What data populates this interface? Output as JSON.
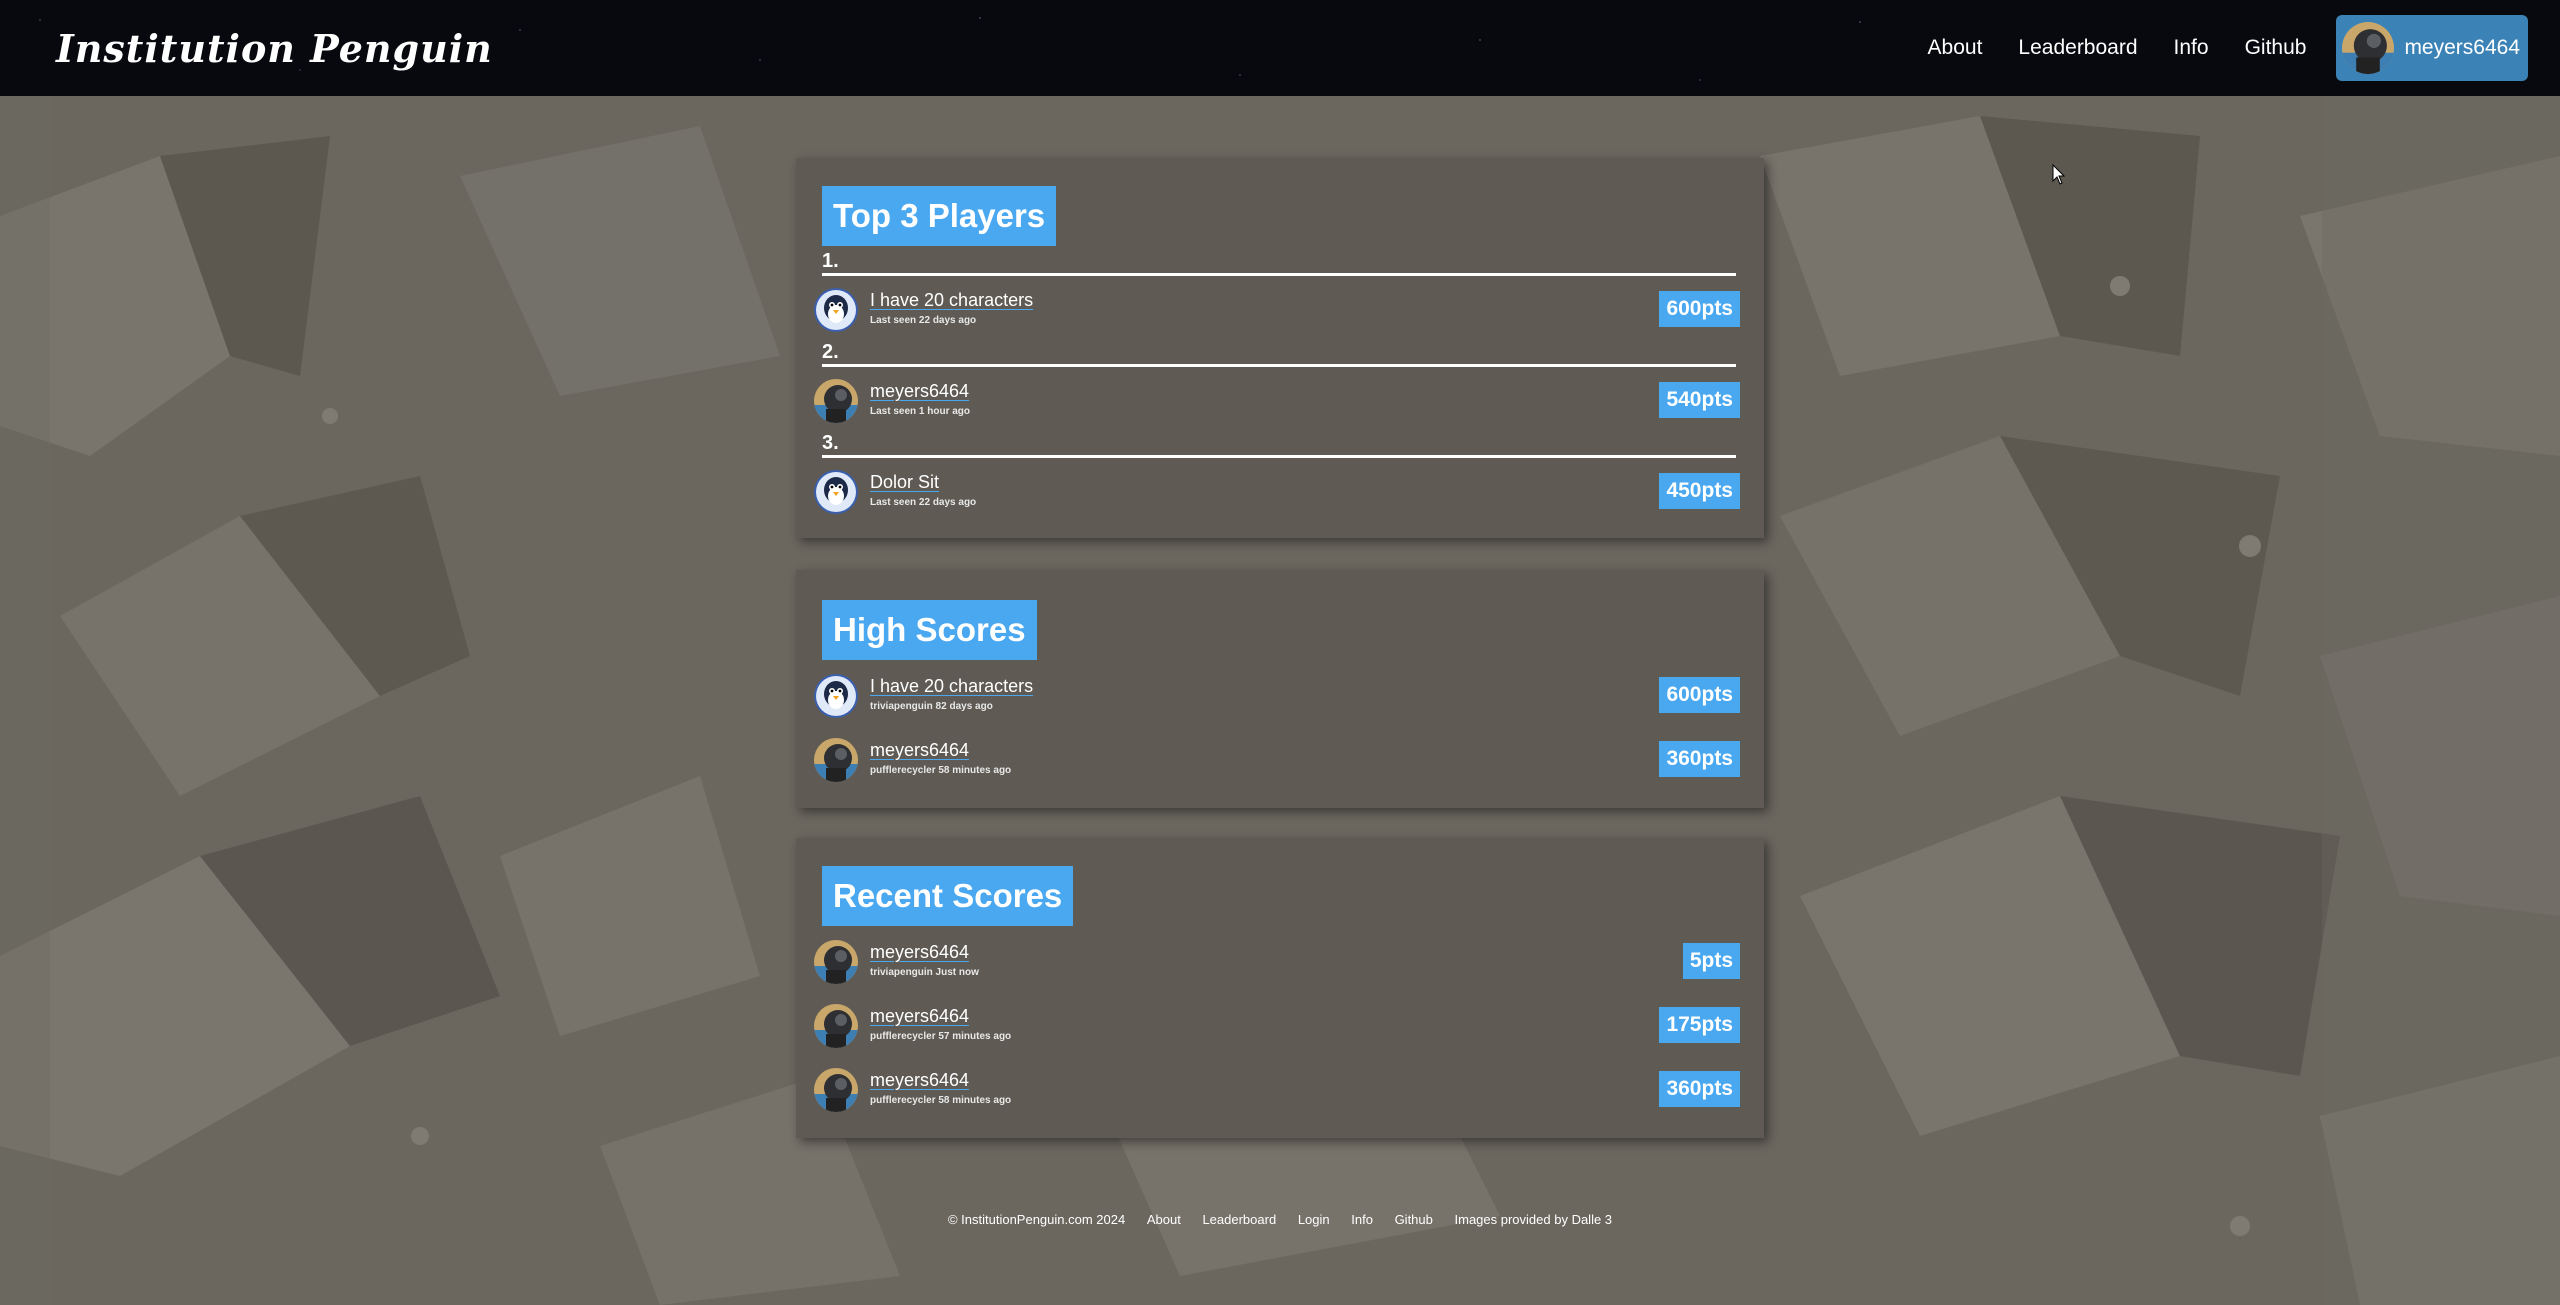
{
  "header": {
    "brand": "Institution Penguin",
    "nav": [
      "About",
      "Leaderboard",
      "Info",
      "Github"
    ],
    "user": "meyers6464"
  },
  "top3": {
    "title": "Top 3 Players",
    "ranks": [
      "1.",
      "2.",
      "3."
    ],
    "players": [
      {
        "name": "I have 20 characters",
        "sub": "Last seen 22 days ago",
        "pts": "600pts",
        "avatar": "penguin-avatar"
      },
      {
        "name": "meyers6464",
        "sub": "Last seen 1 hour ago",
        "pts": "540pts",
        "avatar": "user-photo-avatar"
      },
      {
        "name": "Dolor Sit",
        "sub": "Last seen 22 days ago",
        "pts": "450pts",
        "avatar": "penguin-avatar"
      }
    ]
  },
  "high_scores": {
    "title": "High Scores",
    "rows": [
      {
        "name": "I have 20 characters",
        "sub": "triviapenguin 82 days ago",
        "pts": "600pts",
        "avatar": "penguin-avatar"
      },
      {
        "name": "meyers6464",
        "sub": "pufflerecycler 58 minutes ago",
        "pts": "360pts",
        "avatar": "user-photo-avatar"
      }
    ]
  },
  "recent_scores": {
    "title": "Recent Scores",
    "rows": [
      {
        "name": "meyers6464",
        "sub": "triviapenguin Just now",
        "pts": "5pts",
        "avatar": "user-photo-avatar"
      },
      {
        "name": "meyers6464",
        "sub": "pufflerecycler 57 minutes ago",
        "pts": "175pts",
        "avatar": "user-photo-avatar"
      },
      {
        "name": "meyers6464",
        "sub": "pufflerecycler 58 minutes ago",
        "pts": "360pts",
        "avatar": "user-photo-avatar"
      }
    ]
  },
  "footer": {
    "copyright": "© InstitutionPenguin.com 2024",
    "links": [
      "About",
      "Leaderboard",
      "Login",
      "Info",
      "Github"
    ],
    "credit": "Images provided by Dalle 3"
  },
  "colors": {
    "accent": "#4aa8f0",
    "navbar": "#07090f",
    "panel": "#5f5b54",
    "background": "#6a665e",
    "user_chip": "#3b82b6"
  }
}
